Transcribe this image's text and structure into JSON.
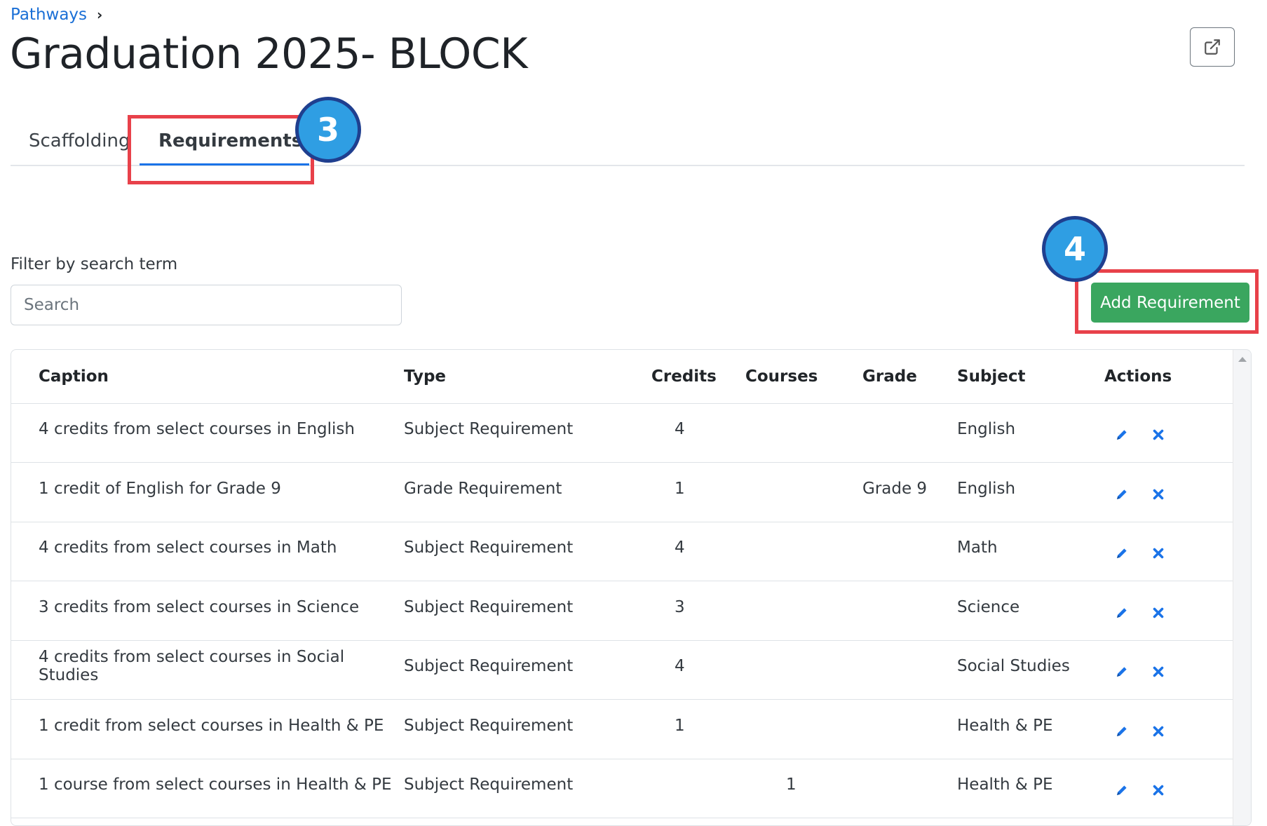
{
  "breadcrumb": {
    "link": "Pathways",
    "separator": "›"
  },
  "title": "Graduation 2025- BLOCK",
  "tabs": [
    {
      "label": "Scaffolding",
      "active": false
    },
    {
      "label": "Requirements",
      "active": true
    }
  ],
  "annotations": [
    {
      "number": "3"
    },
    {
      "number": "4"
    }
  ],
  "filter": {
    "label": "Filter by search term",
    "placeholder": "Search"
  },
  "add_button": {
    "label": "Add Requirement"
  },
  "table": {
    "headers": [
      "Caption",
      "Type",
      "Credits",
      "Courses",
      "Grade",
      "Subject",
      "Actions"
    ],
    "rows": [
      {
        "caption": "4 credits from select courses in English",
        "type": "Subject Requirement",
        "credits": "4",
        "courses": "",
        "grade": "",
        "subject": "English"
      },
      {
        "caption": "1 credit of English for Grade 9",
        "type": "Grade Requirement",
        "credits": "1",
        "courses": "",
        "grade": "Grade 9",
        "subject": "English"
      },
      {
        "caption": "4 credits from select courses in Math",
        "type": "Subject Requirement",
        "credits": "4",
        "courses": "",
        "grade": "",
        "subject": "Math"
      },
      {
        "caption": "3 credits from select courses in Science",
        "type": "Subject Requirement",
        "credits": "3",
        "courses": "",
        "grade": "",
        "subject": "Science"
      },
      {
        "caption": "4 credits from select courses in Social Studies",
        "type": "Subject Requirement",
        "credits": "4",
        "courses": "",
        "grade": "",
        "subject": "Social Studies"
      },
      {
        "caption": "1 credit from select courses in Health & PE",
        "type": "Subject Requirement",
        "credits": "1",
        "courses": "",
        "grade": "",
        "subject": "Health & PE"
      },
      {
        "caption": "1 course from select courses in Health & PE",
        "type": "Subject Requirement",
        "credits": "",
        "courses": "1",
        "grade": "",
        "subject": "Health & PE"
      }
    ]
  },
  "icons": {
    "external": "external-link-icon",
    "edit": "pencil-icon",
    "delete": "x-icon",
    "chevron": "chevron-right-icon"
  },
  "colors": {
    "link": "#1a6fd6",
    "accent": "#1a73e8",
    "success": "#3aa65f",
    "annotation": "#e8414a",
    "badge": "#2f9ee3",
    "icon": "#1a73e8"
  }
}
